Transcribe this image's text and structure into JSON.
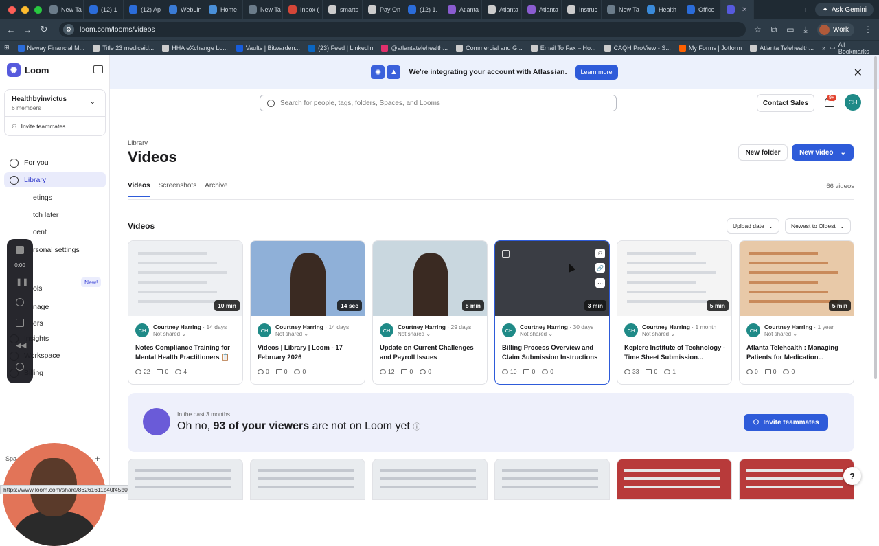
{
  "browser": {
    "tabs": [
      {
        "label": "New Ta",
        "color": "#6b7c8a"
      },
      {
        "label": "(12) 1",
        "color": "#2b6cd9"
      },
      {
        "label": "(12) Ap",
        "color": "#2b6cd9"
      },
      {
        "label": "WebLin",
        "color": "#3a7bd5"
      },
      {
        "label": "Home",
        "color": "#4a90d9"
      },
      {
        "label": "New Ta",
        "color": "#6b7c8a"
      },
      {
        "label": "Inbox (",
        "color": "#d44638"
      },
      {
        "label": "smarts",
        "color": "#cccccc"
      },
      {
        "label": "Pay On",
        "color": "#cccccc"
      },
      {
        "label": "(12) 1.",
        "color": "#2b6cd9"
      },
      {
        "label": "Atlanta",
        "color": "#8a5cd0"
      },
      {
        "label": "Atlanta",
        "color": "#cccccc"
      },
      {
        "label": "Atlanta",
        "color": "#8a5cd0"
      },
      {
        "label": "Instruc",
        "color": "#cccccc"
      },
      {
        "label": "New Ta",
        "color": "#6b7c8a"
      },
      {
        "label": "Health",
        "color": "#3a8ad9"
      },
      {
        "label": "Office",
        "color": "#2b6cd9"
      },
      {
        "label": "",
        "color": "#565add"
      }
    ],
    "ask_gemini": "Ask Gemini",
    "url": "loom.com/looms/videos",
    "profile": "Work",
    "bookmarks": [
      {
        "label": "Neway Financial M...",
        "color": "#2b6cd9"
      },
      {
        "label": "Title 23 medicaid...",
        "color": "#cccccc"
      },
      {
        "label": "HHA eXchange Lo...",
        "color": "#cccccc"
      },
      {
        "label": "Vaults | Bitwarden...",
        "color": "#175ddc"
      },
      {
        "label": "(23) Feed | LinkedIn",
        "color": "#0a66c2"
      },
      {
        "label": "@atlantatelehealth...",
        "color": "#e1306c"
      },
      {
        "label": "Commercial and G...",
        "color": "#cccccc"
      },
      {
        "label": "Email To Fax – Ho...",
        "color": "#cccccc"
      },
      {
        "label": "CAQH ProView - S...",
        "color": "#cccccc"
      },
      {
        "label": "My Forms | Jotform",
        "color": "#ff6100"
      },
      {
        "label": "Atlanta Telehealth...",
        "color": "#cccccc"
      }
    ],
    "all_bookmarks": "All Bookmarks",
    "status_url": "https://www.loom.com/share/86261611c40f45b0a1f4632d2c40e5a0"
  },
  "sidebar": {
    "brand": "Loom",
    "workspace_name": "Healthbyinvictus",
    "workspace_members": "6 members",
    "invite": "Invite teammates",
    "items": [
      {
        "label": "For you"
      },
      {
        "label": "Library"
      },
      {
        "label": "etings"
      },
      {
        "label": "tch later"
      },
      {
        "label": "cent"
      },
      {
        "label": "rsonal settings"
      },
      {
        "label": "ols"
      },
      {
        "label": "nage"
      },
      {
        "label": "ers"
      },
      {
        "label": "Insights"
      },
      {
        "label": "Workspace"
      },
      {
        "label": "Billing"
      }
    ],
    "new_badge": "New!",
    "spaces": "Spa",
    "rec_time": "0:00"
  },
  "banner": {
    "message": "We're integrating your account with Atlassian.",
    "learn_more": "Learn more"
  },
  "header": {
    "search_placeholder": "Search for people, tags, folders, Spaces, and Looms",
    "contact_sales": "Contact Sales",
    "notif_badge": "9+",
    "avatar": "CH"
  },
  "library": {
    "breadcrumb": "Library",
    "title": "Videos",
    "new_folder": "New folder",
    "new_video": "New video",
    "tabs": [
      "Videos",
      "Screenshots",
      "Archive"
    ],
    "count": "66 videos",
    "section": "Videos",
    "sort_upload": "Upload date",
    "sort_order": "Newest to Oldest"
  },
  "videos": [
    {
      "author": "Courtney Harring",
      "age": "14 days",
      "share": "Not shared",
      "title": "Notes Compliance Training for Mental Health Practitioners 📋",
      "duration": "10 min",
      "views": "22",
      "comments": "0",
      "reactions": "4",
      "thumb": "#eef0f3"
    },
    {
      "author": "Courtney Harring",
      "age": "14 days",
      "share": "Not shared",
      "title": "Videos | Library | Loom - 17 February 2026",
      "duration": "14 sec",
      "views": "0",
      "comments": "0",
      "reactions": "0",
      "thumb": "#8fb0d8"
    },
    {
      "author": "Courtney Harring",
      "age": "29 days",
      "share": "Not shared",
      "title": "Update on Current Challenges and Payroll Issues",
      "duration": "8 min",
      "views": "12",
      "comments": "0",
      "reactions": "0",
      "thumb": "#c9d7df"
    },
    {
      "author": "Courtney Harring",
      "age": "30 days",
      "share": "Not shared",
      "title": "Billing Process Overview and Claim Submission Instructions",
      "duration": "3 min",
      "views": "10",
      "comments": "0",
      "reactions": "0",
      "thumb": "#3a3d44"
    },
    {
      "author": "Courtney Harring",
      "age": "1 month",
      "share": "Not shared",
      "title": "Keplere Institute of Technology - Time Sheet Submission...",
      "duration": "5 min",
      "views": "33",
      "comments": "0",
      "reactions": "1",
      "thumb": "#f4f4f4"
    },
    {
      "author": "Courtney Harring",
      "age": "1 year",
      "share": "Not shared",
      "title": "Atlanta Telehealth : Managing Patients for Medication...",
      "duration": "5 min",
      "views": "0",
      "comments": "0",
      "reactions": "0",
      "thumb": "#e8c9a8"
    }
  ],
  "promo": {
    "subtitle": "In the past 3 months",
    "prefix": "Oh no,",
    "highlight": "93 of your viewers",
    "suffix": "are not on Loom yet",
    "button": "Invite teammates"
  },
  "help": "?"
}
